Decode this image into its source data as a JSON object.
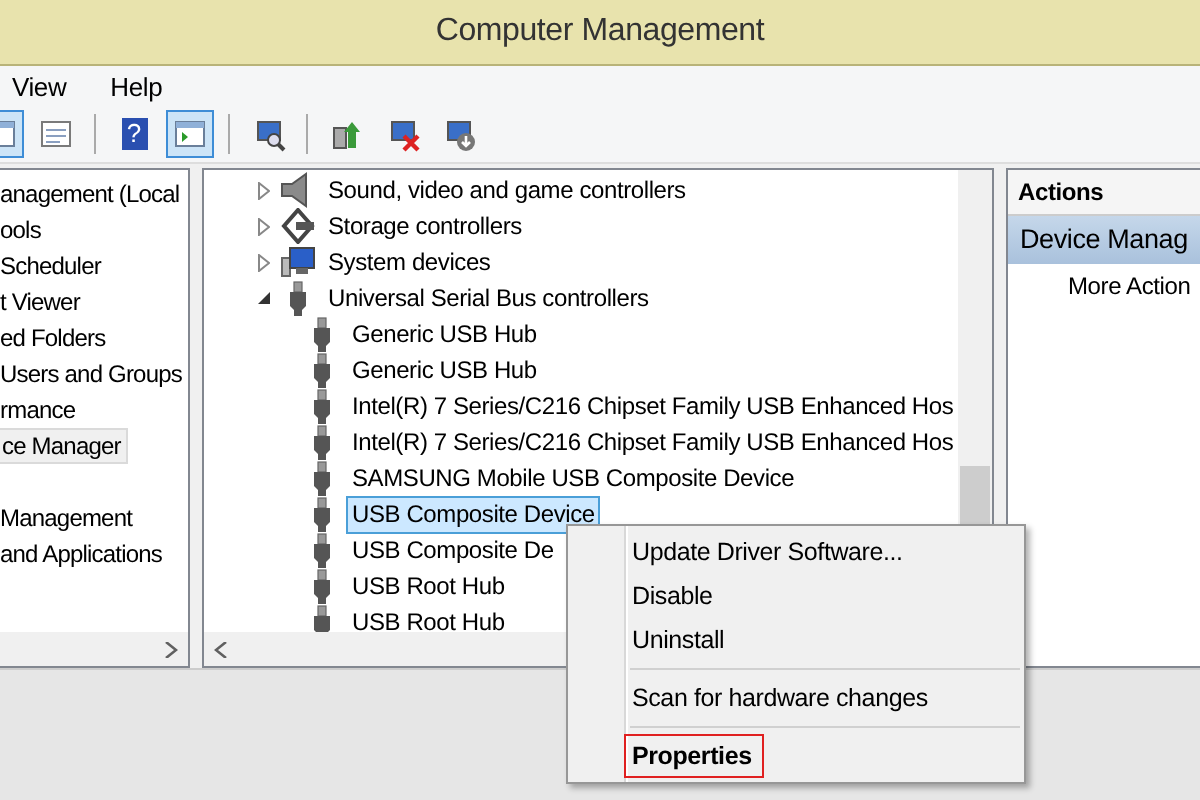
{
  "window": {
    "title": "Computer Management"
  },
  "menu": [
    "View",
    "Help"
  ],
  "toolbar": [
    {
      "kind": "window",
      "selected": true
    },
    {
      "kind": "list",
      "selected": false
    },
    {
      "kind": "help",
      "selected": false,
      "label": "?"
    },
    {
      "kind": "window",
      "selected": true
    },
    {
      "kind": "scan",
      "selected": false
    },
    {
      "kind": "update",
      "selected": false
    },
    {
      "kind": "remove",
      "selected": false
    },
    {
      "kind": "download",
      "selected": false
    }
  ],
  "sidebar": {
    "groups": [
      {
        "items": [
          {
            "label": "anagement (Local",
            "selected": false
          },
          {
            "label": "ools",
            "selected": false
          },
          {
            "label": "Scheduler",
            "selected": false
          },
          {
            "label": "t Viewer",
            "selected": false
          },
          {
            "label": "ed Folders",
            "selected": false
          },
          {
            "label": "Users and Groups",
            "selected": false
          },
          {
            "label": "rmance",
            "selected": false
          },
          {
            "label": "ce Manager",
            "selected": true
          }
        ]
      },
      {
        "items": [
          {
            "label": "Management",
            "selected": false
          },
          {
            "label": "and Applications",
            "selected": false
          }
        ]
      }
    ]
  },
  "devices": [
    {
      "label": "Sound, video and game controllers",
      "kind": "speaker",
      "expanded": false,
      "selected": false
    },
    {
      "label": "Storage controllers",
      "kind": "storage",
      "expanded": false,
      "selected": false
    },
    {
      "label": "System devices",
      "kind": "monitor",
      "expanded": false,
      "selected": false
    },
    {
      "label": "Universal Serial Bus controllers",
      "kind": "usb",
      "expanded": true,
      "selected": false,
      "children": [
        {
          "label": "Generic USB Hub",
          "kind": "usb",
          "selected": false
        },
        {
          "label": "Generic USB Hub",
          "kind": "usb",
          "selected": false
        },
        {
          "label": "Intel(R) 7 Series/C216 Chipset Family USB Enhanced Hos",
          "kind": "usb",
          "selected": false
        },
        {
          "label": "Intel(R) 7 Series/C216 Chipset Family USB Enhanced Hos",
          "kind": "usb",
          "selected": false
        },
        {
          "label": "SAMSUNG Mobile USB Composite Device",
          "kind": "usb",
          "selected": false
        },
        {
          "label": "USB Composite Device",
          "kind": "usb",
          "selected": true
        },
        {
          "label": "USB Composite De",
          "kind": "usb",
          "selected": false
        },
        {
          "label": "USB Root Hub",
          "kind": "usb",
          "selected": false
        },
        {
          "label": "USB Root Hub",
          "kind": "usb",
          "selected": false
        }
      ]
    }
  ],
  "actions": {
    "header": "Actions",
    "items": [
      {
        "label": "Device Manag",
        "selected": true
      },
      {
        "label": "More Action",
        "selected": false
      }
    ]
  },
  "context_menu": [
    {
      "label": "Update Driver Software...",
      "bold": false,
      "highlighted": false,
      "separator_after": false
    },
    {
      "label": "Disable",
      "bold": false,
      "highlighted": false,
      "separator_after": false
    },
    {
      "label": "Uninstall",
      "bold": false,
      "highlighted": false,
      "separator_after": true
    },
    {
      "label": "Scan for hardware changes",
      "bold": false,
      "highlighted": false,
      "separator_after": true
    },
    {
      "label": "Properties",
      "bold": true,
      "highlighted": true,
      "separator_after": false
    }
  ]
}
